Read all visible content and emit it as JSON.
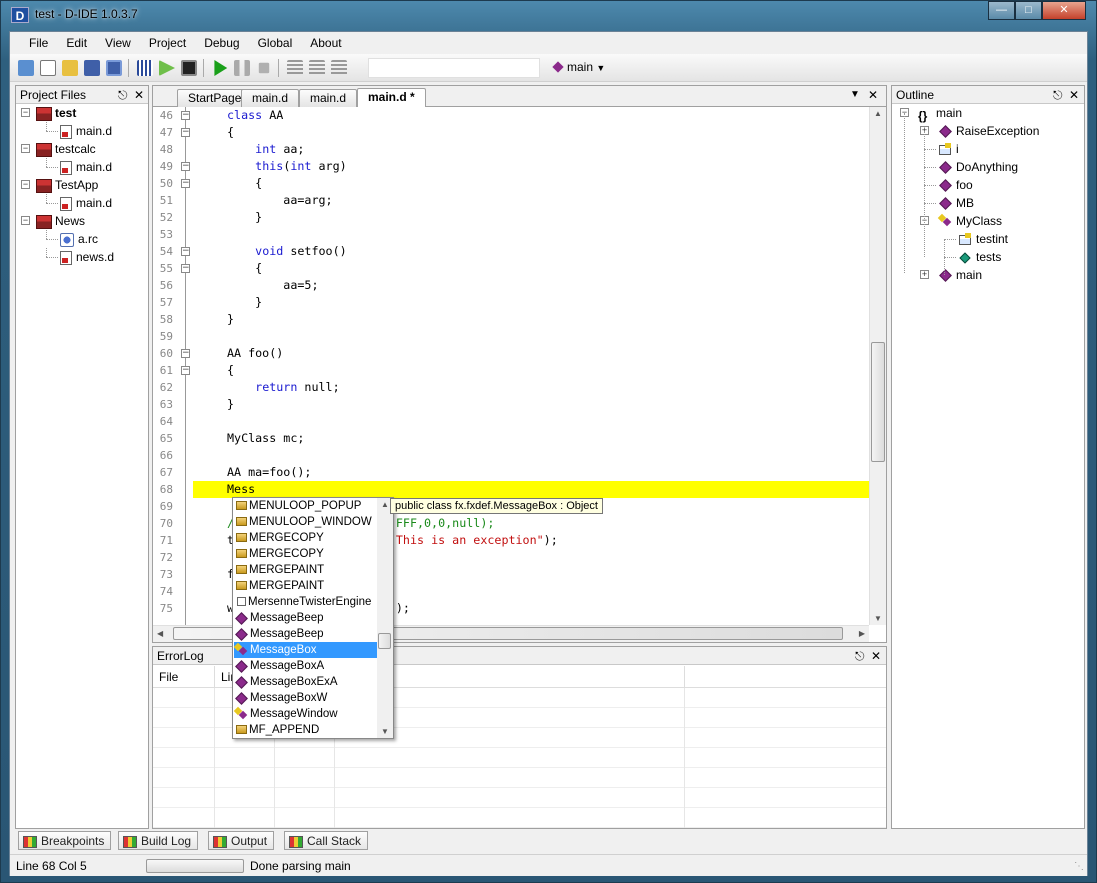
{
  "window": {
    "title": "test - D-IDE 1.0.3.7",
    "app_icon_letter": "D"
  },
  "menu": [
    "File",
    "Edit",
    "View",
    "Project",
    "Debug",
    "Global",
    "About"
  ],
  "toolbar": {
    "config_label": "main"
  },
  "project_panel": {
    "title": "Project Files",
    "tree": [
      {
        "label": "test",
        "type": "project",
        "bold": true,
        "level": 0
      },
      {
        "label": "main.d",
        "type": "file",
        "level": 1
      },
      {
        "label": "testcalc",
        "type": "project",
        "level": 0
      },
      {
        "label": "main.d",
        "type": "file",
        "level": 1
      },
      {
        "label": "TestApp",
        "type": "project",
        "level": 0
      },
      {
        "label": "main.d",
        "type": "file",
        "level": 1
      },
      {
        "label": "News",
        "type": "project",
        "level": 0
      },
      {
        "label": "a.rc",
        "type": "resource",
        "level": 1
      },
      {
        "label": "news.d",
        "type": "file",
        "level": 1
      }
    ]
  },
  "editor": {
    "tabs": [
      {
        "label": "StartPage"
      },
      {
        "label": "main.d"
      },
      {
        "label": "main.d"
      },
      {
        "label": "main.d *",
        "active": true
      }
    ],
    "lines": [
      {
        "n": "46",
        "fold": "-",
        "html": "<span class='kw'>class</span> AA"
      },
      {
        "n": "47",
        "fold": "-",
        "html": "{"
      },
      {
        "n": "48",
        "html": "    <span class='kw'>int</span> aa;"
      },
      {
        "n": "49",
        "fold": "-",
        "html": "    <span class='kw'>this</span>(<span class='kw'>int</span> arg)"
      },
      {
        "n": "50",
        "fold": "-",
        "html": "    {"
      },
      {
        "n": "51",
        "html": "        aa=arg;"
      },
      {
        "n": "52",
        "html": "    }"
      },
      {
        "n": "53",
        "html": ""
      },
      {
        "n": "54",
        "fold": "-",
        "html": "    <span class='kw'>void</span> setfoo()"
      },
      {
        "n": "55",
        "fold": "-",
        "html": "    {"
      },
      {
        "n": "56",
        "html": "        aa=5;"
      },
      {
        "n": "57",
        "html": "    }"
      },
      {
        "n": "58",
        "html": "}"
      },
      {
        "n": "59",
        "html": ""
      },
      {
        "n": "60",
        "fold": "-",
        "html": "AA foo()"
      },
      {
        "n": "61",
        "fold": "-",
        "html": "{"
      },
      {
        "n": "62",
        "html": "    <span class='kw'>return</span> null;"
      },
      {
        "n": "63",
        "html": "}"
      },
      {
        "n": "64",
        "html": ""
      },
      {
        "n": "65",
        "html": "MyClass mc;"
      },
      {
        "n": "66",
        "html": ""
      },
      {
        "n": "67",
        "html": "AA ma=foo();"
      },
      {
        "n": "68",
        "html": "Mess",
        "highlight": true
      },
      {
        "n": "69",
        "html": ""
      },
      {
        "n": "70",
        "html": "<span class='cm'>/                       FFF,0,0,null);</span>"
      },
      {
        "n": "71",
        "html": "t                       <span class='str'>This is an exception\"</span>);"
      },
      {
        "n": "72",
        "html": ""
      },
      {
        "n": "73",
        "html": "f"
      },
      {
        "n": "74",
        "html": ""
      },
      {
        "n": "75",
        "html": "w                       );"
      }
    ]
  },
  "autocomplete": {
    "items": [
      {
        "label": "MENULOOP_POPUP",
        "icon": "const"
      },
      {
        "label": "MENULOOP_WINDOW",
        "icon": "const"
      },
      {
        "label": "MERGECOPY",
        "icon": "const"
      },
      {
        "label": "MERGECOPY",
        "icon": "const"
      },
      {
        "label": "MERGEPAINT",
        "icon": "const"
      },
      {
        "label": "MERGEPAINT",
        "icon": "const"
      },
      {
        "label": "MersenneTwisterEngine",
        "icon": "struct"
      },
      {
        "label": "MessageBeep",
        "icon": "method"
      },
      {
        "label": "MessageBeep",
        "icon": "method"
      },
      {
        "label": "MessageBox",
        "icon": "class",
        "selected": true
      },
      {
        "label": "MessageBoxA",
        "icon": "method"
      },
      {
        "label": "MessageBoxExA",
        "icon": "method"
      },
      {
        "label": "MessageBoxW",
        "icon": "method"
      },
      {
        "label": "MessageWindow",
        "icon": "class"
      },
      {
        "label": "MF_APPEND",
        "icon": "const"
      }
    ],
    "tooltip": "public class fx.fxdef.MessageBox : Object"
  },
  "errorlog": {
    "title": "ErrorLog",
    "columns": [
      "File",
      "Lin",
      "",
      "n"
    ]
  },
  "outline": {
    "title": "Outline",
    "tree": [
      {
        "label": "main",
        "icon": "braces",
        "level": 0,
        "expander": "-"
      },
      {
        "label": "RaiseException",
        "icon": "method",
        "level": 1,
        "expander": "+"
      },
      {
        "label": "i",
        "icon": "field",
        "level": 1
      },
      {
        "label": "DoAnything",
        "icon": "method",
        "level": 1
      },
      {
        "label": "foo",
        "icon": "method",
        "level": 1
      },
      {
        "label": "MB",
        "icon": "method",
        "level": 1
      },
      {
        "label": "MyClass",
        "icon": "class",
        "level": 1,
        "expander": "-"
      },
      {
        "label": "testint",
        "icon": "field",
        "level": 2
      },
      {
        "label": "tests",
        "icon": "green-method",
        "level": 2
      },
      {
        "label": "main",
        "icon": "method",
        "level": 1,
        "expander": "+"
      }
    ]
  },
  "bottom_tabs": [
    "Breakpoints",
    "Build Log",
    "Output",
    "Call Stack"
  ],
  "status": {
    "position": "Line 68 Col 5",
    "message": "Done parsing main"
  },
  "colors": {
    "keyword": "#1a1ad0",
    "string": "#c21010",
    "comment": "#1a8a1a",
    "highlight": "#ffff00",
    "selection": "#3399ff"
  }
}
